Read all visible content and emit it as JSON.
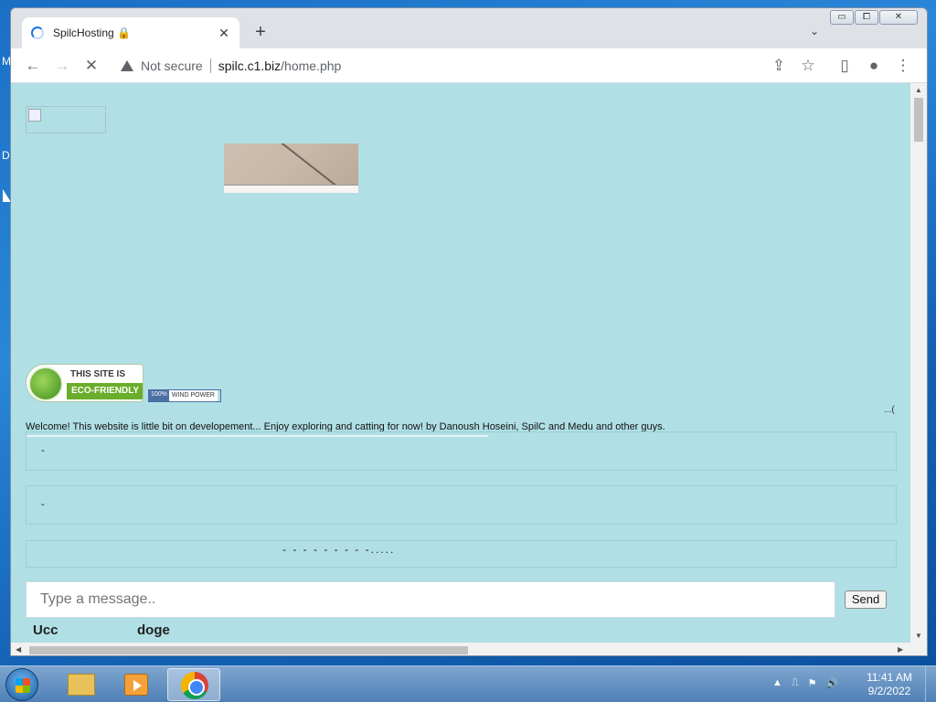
{
  "desktop": {
    "labels": [
      "M",
      "D"
    ]
  },
  "browser": {
    "tab": {
      "title": "SpilcHosting 🔒",
      "close": "✕"
    },
    "new_tab": "+",
    "tab_search": "⌄",
    "window_controls": {
      "minimize": "▭",
      "maximize": "⧠",
      "close": "✕"
    },
    "nav": {
      "back": "←",
      "forward": "→",
      "stop": "✕"
    },
    "address": {
      "security_label": "Not secure",
      "host": "spilc.c1.biz",
      "path": "/home.php"
    },
    "actions": {
      "share": "⇪",
      "bookmark": "☆",
      "sidepanel": "▯",
      "profile": "●",
      "menu": "⋮"
    }
  },
  "page": {
    "eco_badge": {
      "line1": "THIS SITE IS",
      "line2": "ECO-FRIENDLY"
    },
    "wind_badge": {
      "percent": "100%",
      "text": "WIND POWER"
    },
    "right_marker": "...(",
    "welcome": "Welcome! This website is little bit on developement... Enjoy exploring and catting for now! by Danoush Hoseini, SpilC and Medu and other guys.",
    "messages": [
      {
        "text": "-"
      },
      {
        "text": "-"
      },
      {
        "text": "- - - - - - - - -....."
      }
    ],
    "input": {
      "placeholder": "Type a message.."
    },
    "send_label": "Send",
    "overflow_fragments": [
      "Ucc",
      "doge"
    ]
  },
  "taskbar": {
    "apps": [
      "windows-explorer",
      "media-player",
      "chrome"
    ],
    "tray_icons": [
      "▲",
      "⎍",
      "⚑",
      "🔊"
    ],
    "time": "11:41 AM",
    "date": "9/2/2022"
  },
  "colors": {
    "page_bg": "#b0dfe5",
    "accent": "#1a73e8"
  }
}
